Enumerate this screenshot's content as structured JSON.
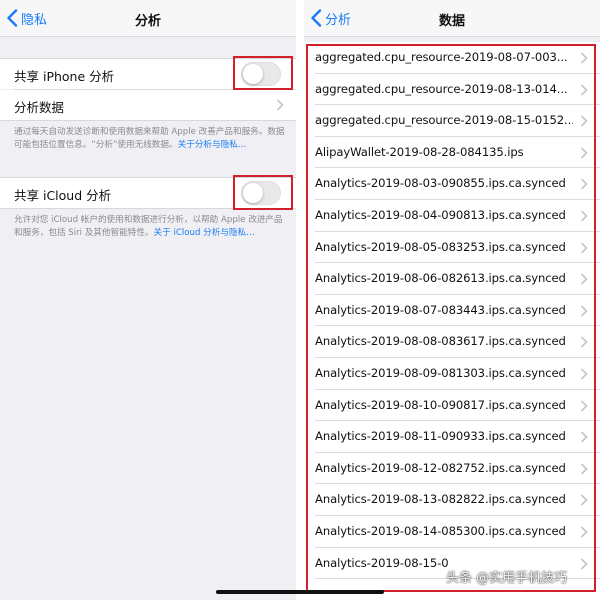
{
  "left": {
    "back_label": "隐私",
    "title": "分析",
    "share_iphone": {
      "label": "共享 iPhone 分析",
      "on": false
    },
    "analysis_data_label": "分析数据",
    "iphone_note": "通过每天自动发送诊断和使用数据来帮助 Apple 改善产品和服务。数据可能包括位置信息。“分析”使用无线数据。",
    "iphone_note_link": "关于分析与隐私…",
    "share_icloud": {
      "label": "共享 iCloud 分析",
      "on": false
    },
    "icloud_note": "允许对您 iCloud 帐户的使用和数据进行分析，以帮助 Apple 改进产品和服务，包括 Siri 及其他智能特性。",
    "icloud_note_link": "关于 iCloud 分析与隐私…"
  },
  "right": {
    "back_label": "分析",
    "title": "数据",
    "files": [
      "aggregated.cpu_resource-2019-08-07-003...",
      "aggregated.cpu_resource-2019-08-13-014...",
      "aggregated.cpu_resource-2019-08-15-0152...",
      "AlipayWallet-2019-08-28-084135.ips",
      "Analytics-2019-08-03-090855.ips.ca.synced",
      "Analytics-2019-08-04-090813.ips.ca.synced",
      "Analytics-2019-08-05-083253.ips.ca.synced",
      "Analytics-2019-08-06-082613.ips.ca.synced",
      "Analytics-2019-08-07-083443.ips.ca.synced",
      "Analytics-2019-08-08-083617.ips.ca.synced",
      "Analytics-2019-08-09-081303.ips.ca.synced",
      "Analytics-2019-08-10-090817.ips.ca.synced",
      "Analytics-2019-08-11-090933.ips.ca.synced",
      "Analytics-2019-08-12-082752.ips.ca.synced",
      "Analytics-2019-08-13-082822.ips.ca.synced",
      "Analytics-2019-08-14-085300.ips.ca.synced",
      "Analytics-2019-08-15-0"
    ]
  },
  "watermark": "头条 @实用手机技巧",
  "icons": {
    "back": "chevron-left-icon",
    "row": "chevron-right-icon"
  },
  "colors": {
    "accent": "#1a7cf4",
    "highlight": "#d4202c",
    "background": "#efeff4",
    "label": "#111111",
    "secondary": "#8a8a8f"
  }
}
